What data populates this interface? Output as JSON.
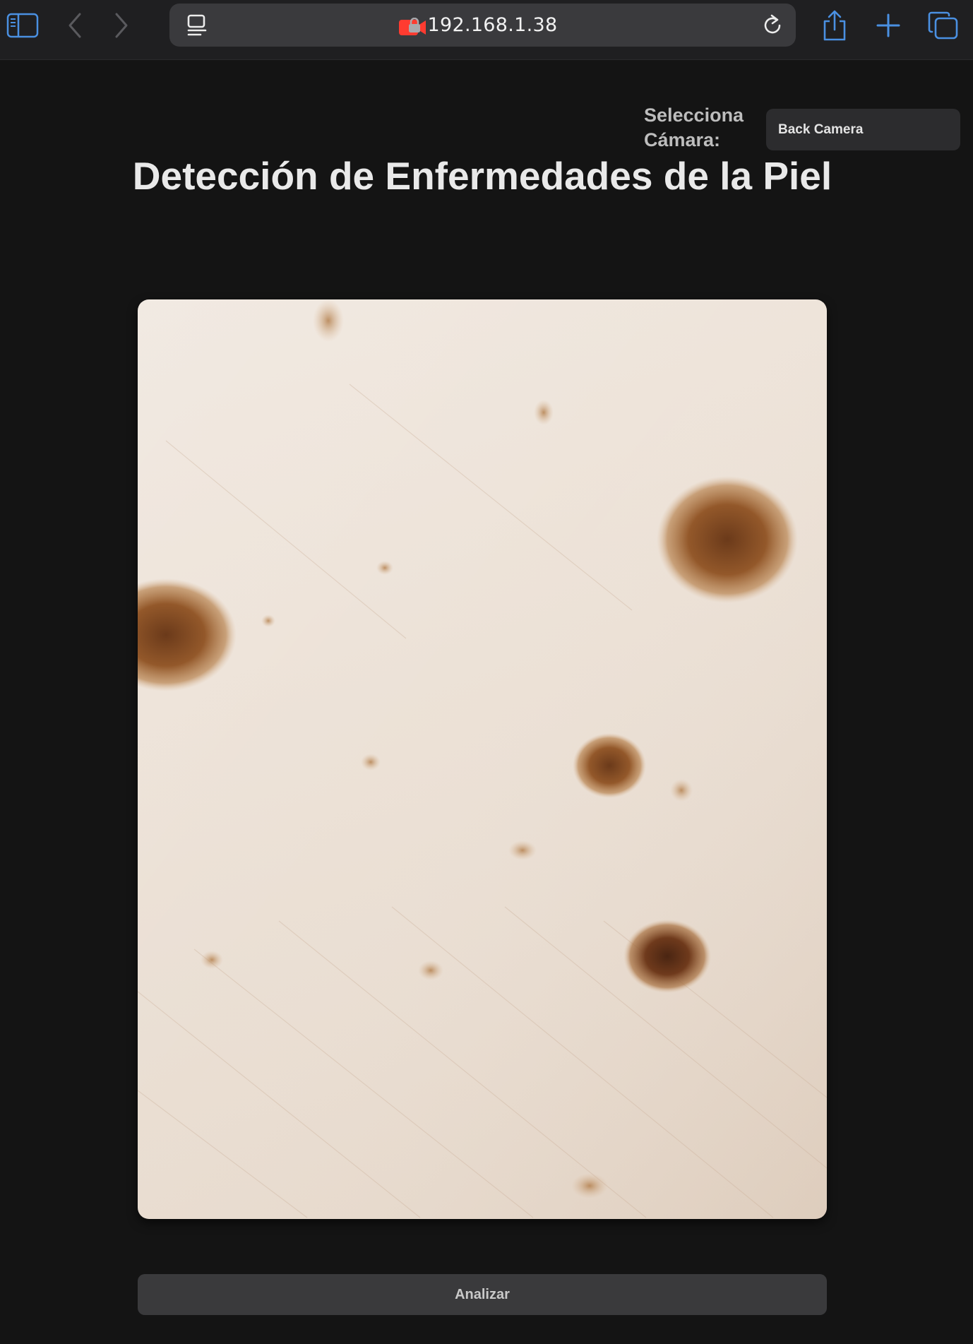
{
  "browser": {
    "url": "192.168.1.38",
    "icons": {
      "sidebar": "sidebar-icon",
      "back": "chevron-left-icon",
      "forward": "chevron-right-icon",
      "reader": "reader-icon",
      "recording": "camera-recording-icon",
      "lock": "lock-icon",
      "reload": "reload-icon",
      "share": "share-icon",
      "new_tab": "plus-icon",
      "tabs": "tabs-icon"
    },
    "accent_color": "#4a90e2",
    "recording_color": "#ff3b30"
  },
  "camera": {
    "label": "Selecciona Cámara:",
    "selected": "Back Camera"
  },
  "page": {
    "title": "Detección de Enfermedades de la Piel"
  },
  "video": {
    "content": "live camera feed"
  },
  "actions": {
    "analyze_label": "Analizar"
  }
}
